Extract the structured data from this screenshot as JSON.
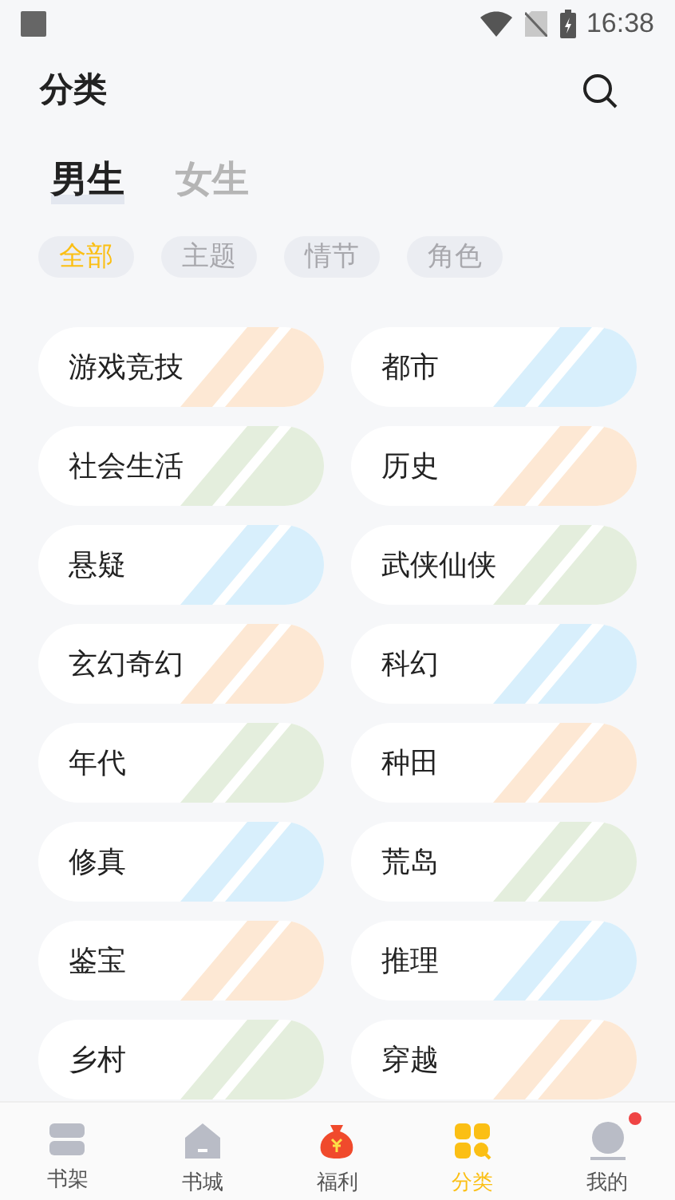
{
  "status_bar": {
    "time": "16:38"
  },
  "header": {
    "title": "分类"
  },
  "tabs": [
    {
      "label": "男生",
      "selected": true
    },
    {
      "label": "女生",
      "selected": false
    }
  ],
  "filters": [
    {
      "label": "全部",
      "selected": true
    },
    {
      "label": "主题",
      "selected": false
    },
    {
      "label": "情节",
      "selected": false
    },
    {
      "label": "角色",
      "selected": false
    }
  ],
  "categories": [
    {
      "label": "游戏竞技",
      "color": "#fde8d4"
    },
    {
      "label": "都市",
      "color": "#d8effc"
    },
    {
      "label": "社会生活",
      "color": "#e4eedd"
    },
    {
      "label": "历史",
      "color": "#fde8d4"
    },
    {
      "label": "悬疑",
      "color": "#d8effc"
    },
    {
      "label": "武侠仙侠",
      "color": "#e4eedd"
    },
    {
      "label": "玄幻奇幻",
      "color": "#fde8d4"
    },
    {
      "label": "科幻",
      "color": "#d8effc"
    },
    {
      "label": "年代",
      "color": "#e4eedd"
    },
    {
      "label": "种田",
      "color": "#fde8d4"
    },
    {
      "label": "修真",
      "color": "#d8effc"
    },
    {
      "label": "荒岛",
      "color": "#e4eedd"
    },
    {
      "label": "鉴宝",
      "color": "#fde8d4"
    },
    {
      "label": "推理",
      "color": "#d8effc"
    },
    {
      "label": "乡村",
      "color": "#e4eedd"
    },
    {
      "label": "穿越",
      "color": "#fde8d4"
    }
  ],
  "bottom_nav": [
    {
      "label": "书架",
      "kind": "shelf",
      "selected": false,
      "badge": false
    },
    {
      "label": "书城",
      "kind": "store",
      "selected": false,
      "badge": false
    },
    {
      "label": "福利",
      "kind": "bag",
      "selected": false,
      "badge": false
    },
    {
      "label": "分类",
      "kind": "grid",
      "selected": true,
      "badge": false
    },
    {
      "label": "我的",
      "kind": "profile",
      "selected": false,
      "badge": true
    }
  ]
}
